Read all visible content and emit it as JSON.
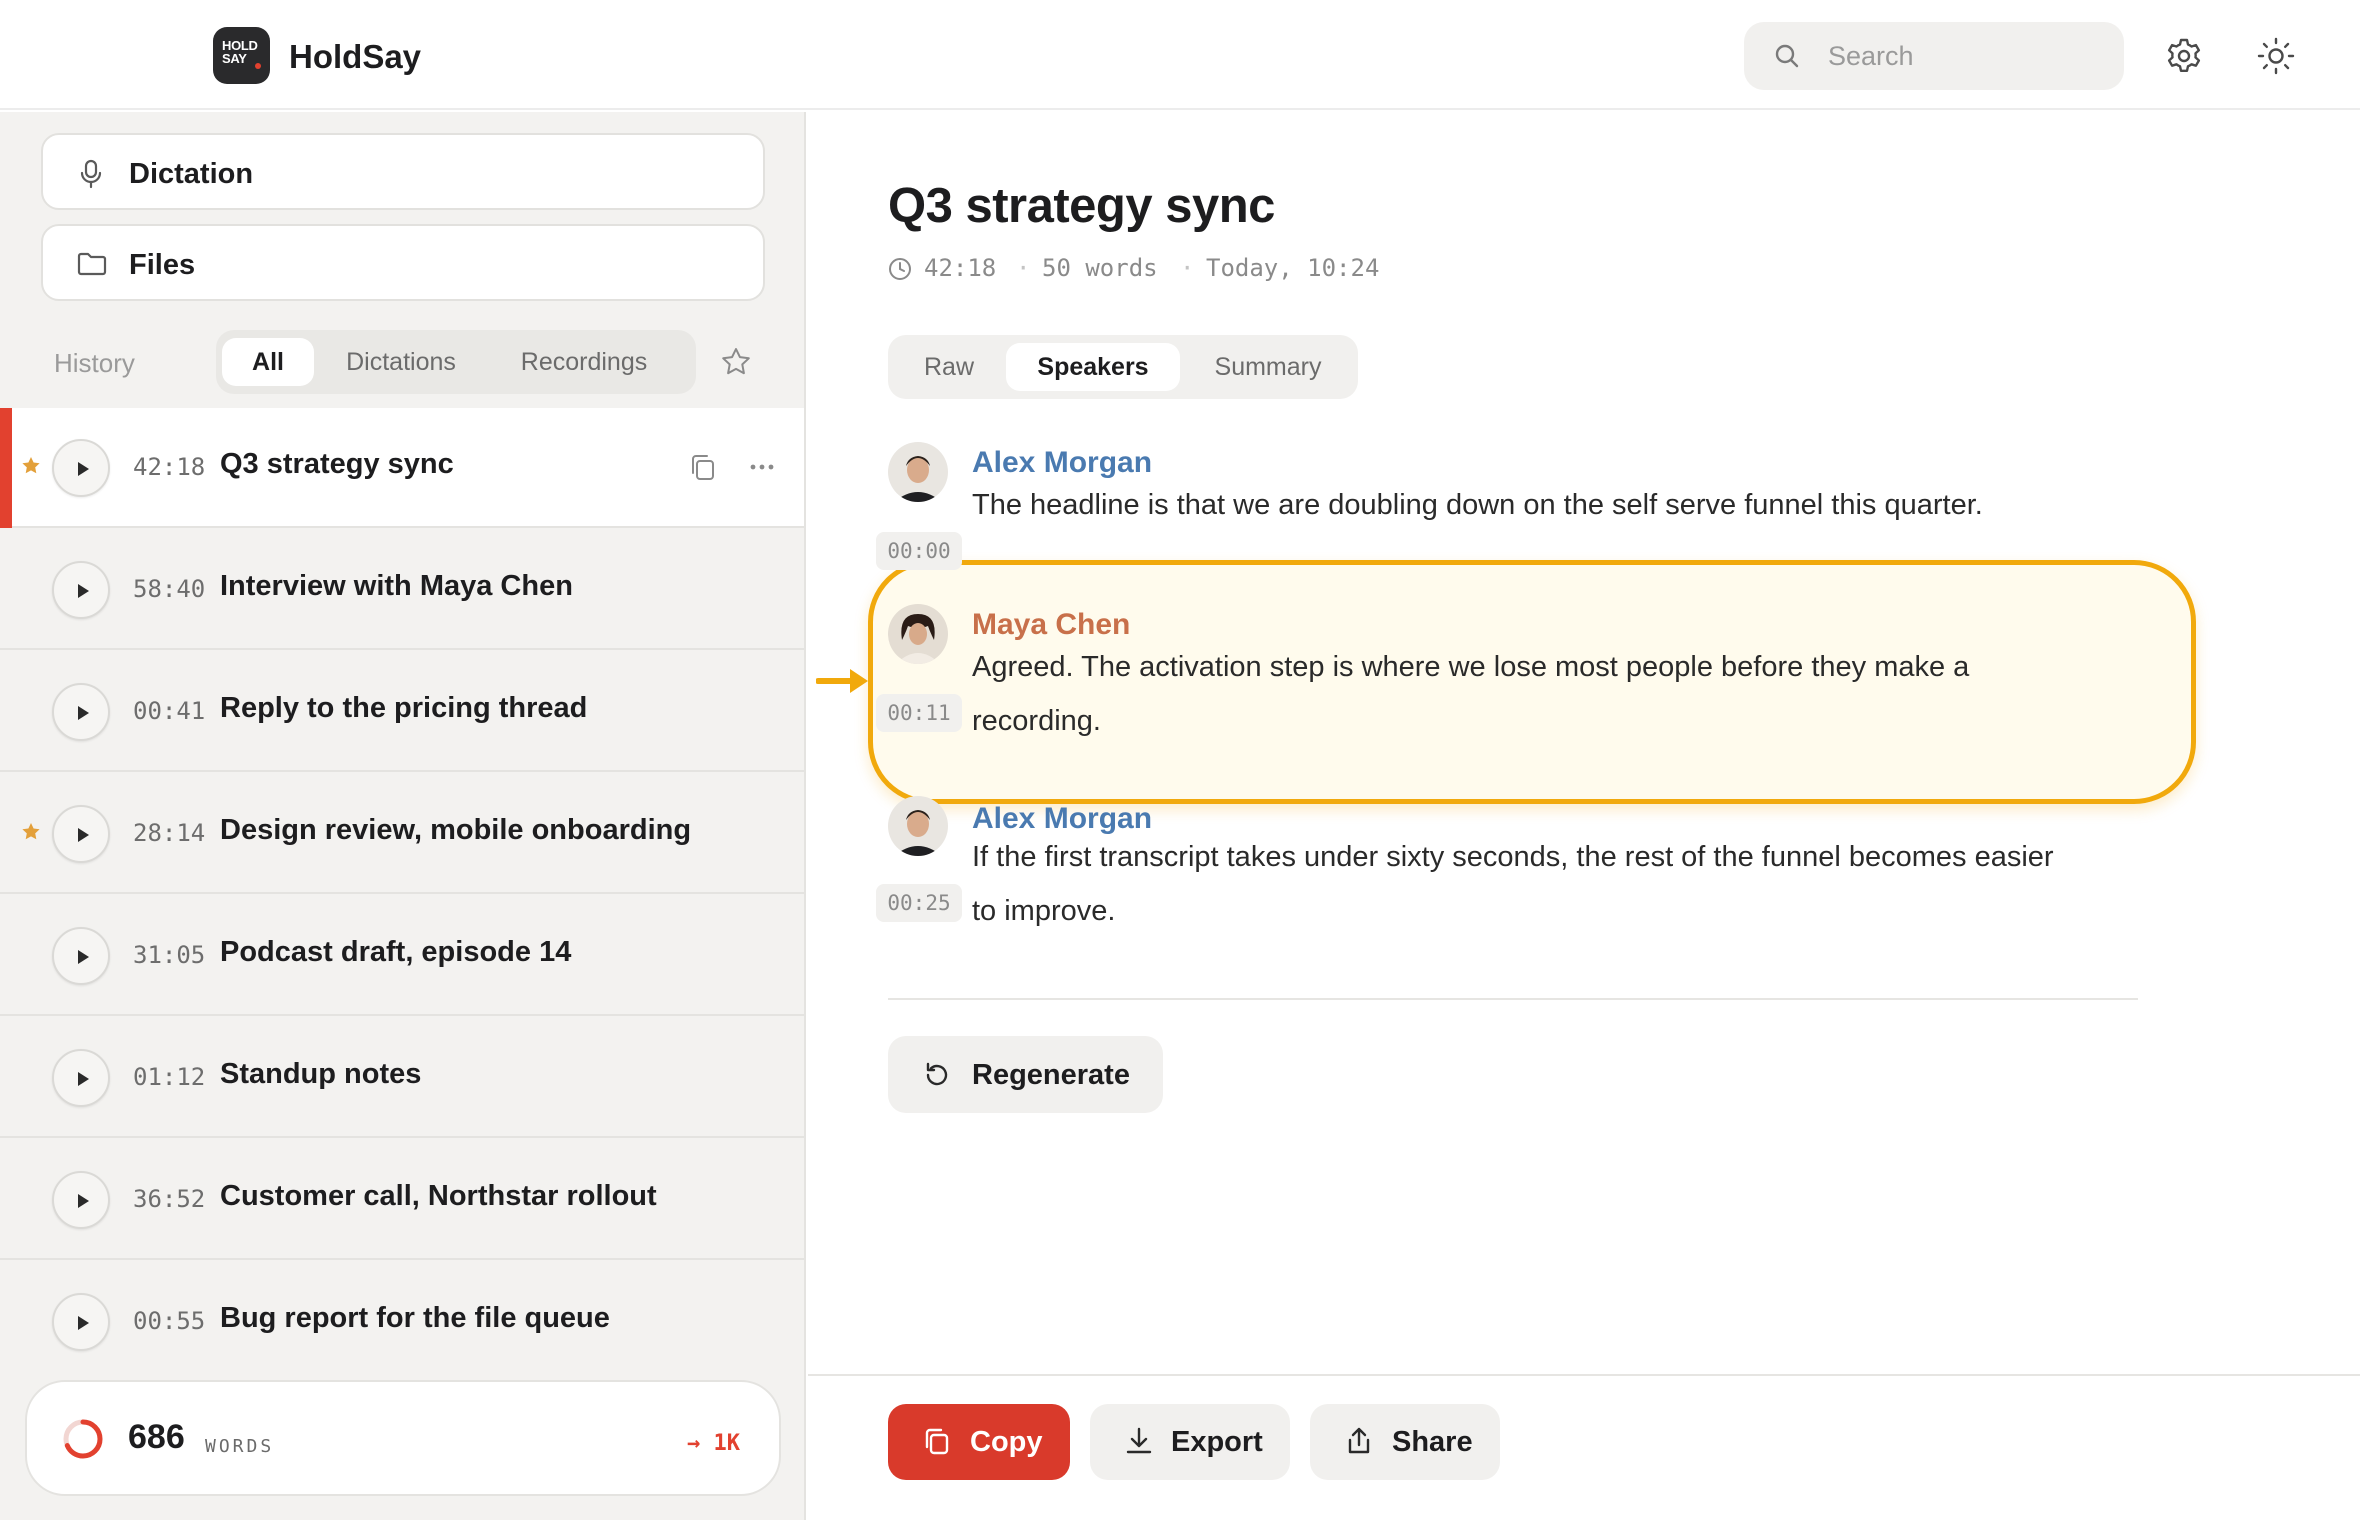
{
  "app": {
    "logo_text_1": "HOLD",
    "logo_text_2": "SAY",
    "name": "HoldSay"
  },
  "header": {
    "search_placeholder": "Search",
    "icons": [
      "search-icon",
      "gear-icon",
      "sun-icon"
    ]
  },
  "sidebar": {
    "dictation_label": "Dictation",
    "files_label": "Files",
    "history_label": "History",
    "filters": [
      "All",
      "Dictations",
      "Recordings"
    ],
    "active_filter": "All",
    "items": [
      {
        "duration": "42:18",
        "title": "Q3 strategy sync",
        "starred": true,
        "active": true
      },
      {
        "duration": "58:40",
        "title": "Interview with Maya Chen",
        "starred": false,
        "active": false
      },
      {
        "duration": "00:41",
        "title": "Reply to the pricing thread",
        "starred": false,
        "active": false
      },
      {
        "duration": "28:14",
        "title": "Design review, mobile onboarding",
        "starred": true,
        "active": false
      },
      {
        "duration": "31:05",
        "title": "Podcast draft, episode 14",
        "starred": false,
        "active": false
      },
      {
        "duration": "01:12",
        "title": "Standup notes",
        "starred": false,
        "active": false
      },
      {
        "duration": "36:52",
        "title": "Customer call, Northstar rollout",
        "starred": false,
        "active": false
      },
      {
        "duration": "00:55",
        "title": "Bug report for the file queue",
        "starred": false,
        "active": false
      }
    ],
    "words": {
      "count": "686",
      "unit": "WORDS",
      "goal": "→ 1K",
      "progress": 0.686
    }
  },
  "main": {
    "title": "Q3 strategy sync",
    "meta": {
      "duration": "42:18",
      "words": "50 words",
      "time": "Today, 10:24",
      "separator": "·"
    },
    "tabs": [
      "Raw",
      "Speakers",
      "Summary"
    ],
    "active_tab": "Speakers",
    "transcript": [
      {
        "timestamp": "00:00",
        "speaker": "Alex Morgan",
        "color": "#4a7ab0",
        "lines": [
          "The headline is that we are doubling down on the self serve funnel this quarter."
        ]
      },
      {
        "timestamp": "00:11",
        "speaker": "Maya Chen",
        "color": "#c8704a",
        "highlighted": true,
        "lines": [
          "Agreed. The activation step is where we lose most people before they make a",
          "recording."
        ]
      },
      {
        "timestamp": "00:25",
        "speaker": "Alex Morgan",
        "color": "#4a7ab0",
        "lines": [
          "If the first transcript takes under sixty seconds, the rest of the funnel becomes easier",
          "to improve."
        ]
      }
    ],
    "regenerate_label": "Regenerate",
    "actions": {
      "copy": "Copy",
      "export": "Export",
      "share": "Share"
    }
  },
  "colors": {
    "accent": "#e2412f",
    "copy_button": "#d93a2b",
    "highlight": "#f1a90c",
    "star": "#e3a03a"
  }
}
